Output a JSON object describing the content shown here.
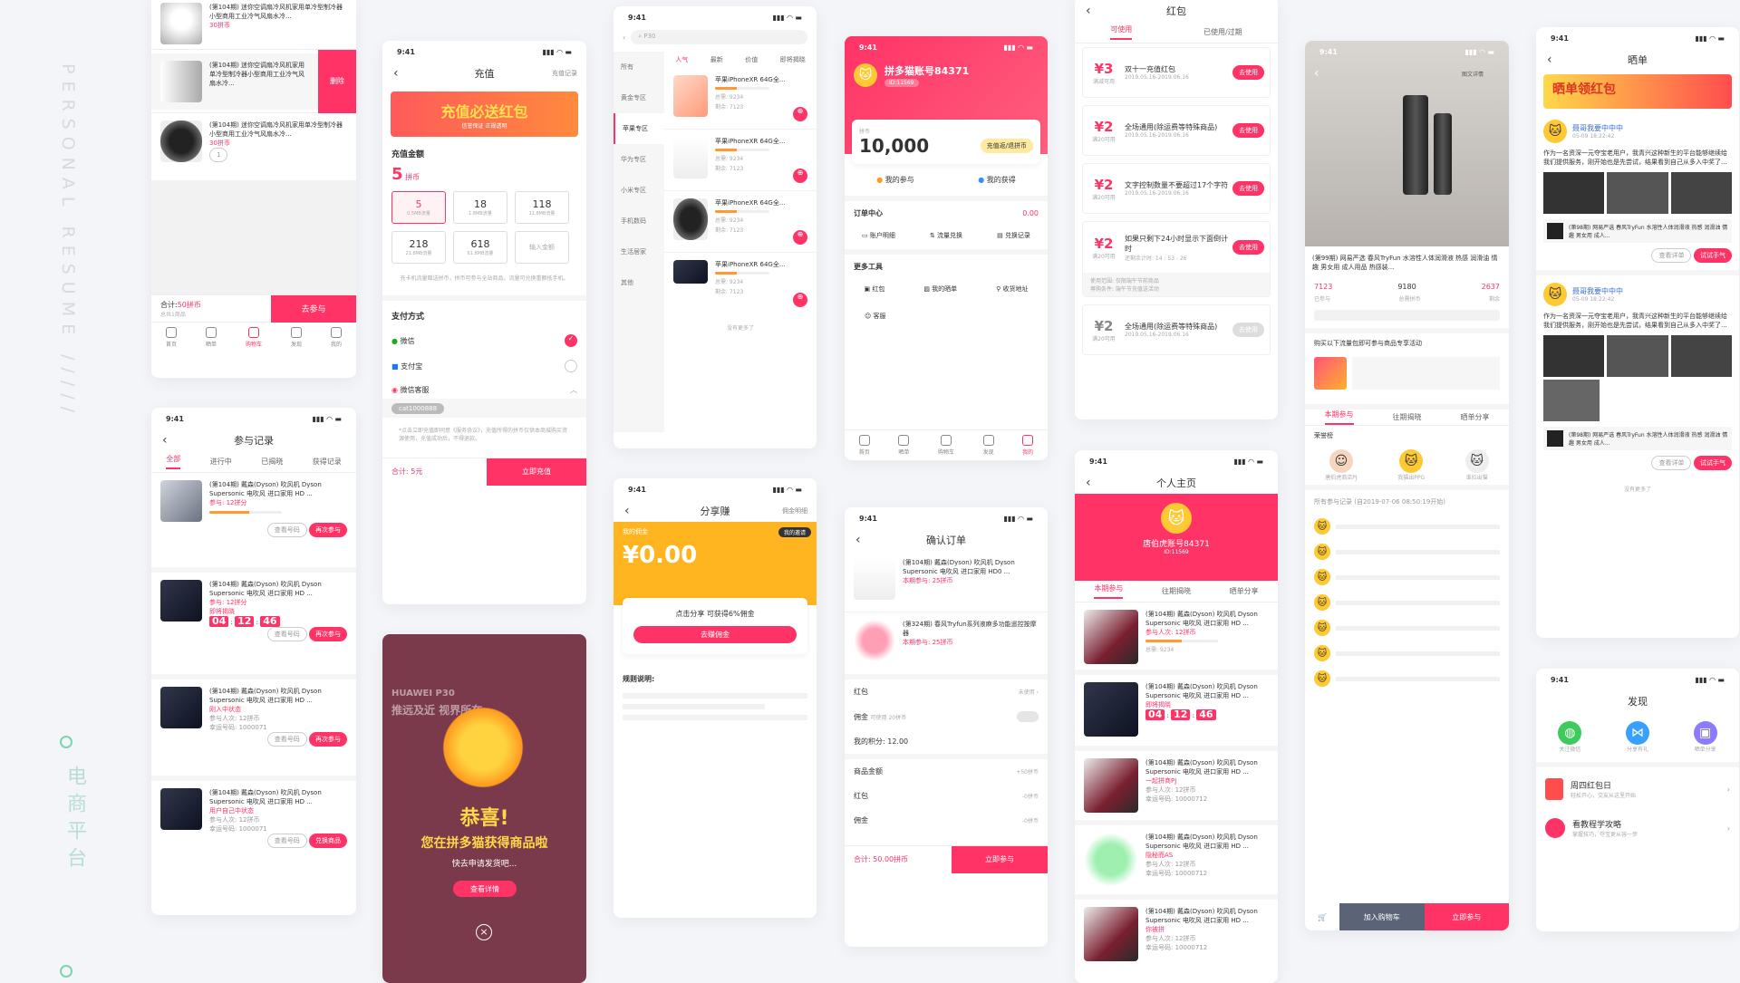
{
  "side": {
    "title": "PERSONAL RESUME /////",
    "cn": "电商平台"
  },
  "common": {
    "time": "9:41",
    "signal": "▮▮▮ ◠ ▬"
  },
  "cart": {
    "name": "(第104期) 迷你空调扇冷风机家用单冷型制冷器小型商用工业冷气风扇水冷...",
    "sum_label": "合计:",
    "sum": "50拼币",
    "count": "总共1商品",
    "go": "去参与",
    "del": "删除",
    "price": "30拼币",
    "qty": "1",
    "tabs": [
      "首页",
      "晒单",
      "购物车",
      "发现",
      "我的"
    ]
  },
  "records": {
    "title": "参与记录",
    "tabs": [
      "全部",
      "进行中",
      "已揭晓",
      "获得记录"
    ],
    "item": "(第104期) 戴森(Dyson) 吹风机 Dyson Supersonic 电吹风 进口家用 HD ...",
    "join": "参与: 12拼分",
    "joined": "参与人次: 12拼币",
    "num": "幸运号码: 1000071",
    "t1": "04",
    "t2": "12",
    "t3": "46",
    "status1": "即将揭晓",
    "status2": "刚入中状态",
    "status3": "用户自己中状态",
    "look": "查看号码",
    "again": "再次参与",
    "get": "兑换商品",
    "bars": "8234",
    "bars2": "7123"
  },
  "recharge": {
    "title": "充值",
    "right": "充值记录",
    "banner": "充值必送红包",
    "banner_sub": "信誉保证 正规透明",
    "amount_label": "充值金额",
    "amount": "5",
    "unit": "拼币",
    "tiles": [
      {
        "v": "5",
        "s": "0.5MB流量"
      },
      {
        "v": "18",
        "s": "1.8MB流量"
      },
      {
        "v": "118",
        "s": "11.8MB流量"
      },
      {
        "v": "218",
        "s": "21.8MB流量"
      },
      {
        "v": "618",
        "s": "61.8MB流量"
      },
      {
        "v": "输入金额",
        "s": ""
      }
    ],
    "note": "充卡机流量赠送拼币，拼币可参与全站商品。流量可兑换重额抵手机。",
    "pay": "支付方式",
    "m1": "微信",
    "m2": "支付宝",
    "m3": "微信客服",
    "sub": "充值",
    "code": "cat1000888",
    "sum": "合计: 5元",
    "btn": "立即充值",
    "tip": "*点击立即充值即同意《服务协议》，充值所得的拼币仅供本商城购买资源使用，充值成功后，不得退款。"
  },
  "prize": {
    "title": "恭喜!",
    "sub": "您在拼多猫获得商品啦",
    "desc": "快去申请发货吧...",
    "btn": "查看详情",
    "huawei": "HUAWEI P30",
    "slogan": "推远及近 视界所在"
  },
  "shop": {
    "search": "P30",
    "cats": [
      "所有",
      "黄金专区",
      "苹果专区",
      "华为专区",
      "小米专区",
      "手机数码",
      "生活居家",
      "其他"
    ],
    "sorts": [
      "人气",
      "最新",
      "价值",
      "即将揭晓"
    ],
    "item": "苹果iPhoneXR 64G全...",
    "total": "总需: 9234",
    "left": "剩余: 7123",
    "more": "没有更多了"
  },
  "share": {
    "title": "分享赚",
    "right": "佣金明细",
    "label": "我的佣金",
    "amount": "¥0.00",
    "badge": "我的邀请",
    "hint": "点击分享 可获得6%佣金",
    "btn": "去赚佣金",
    "rule": "规则说明:"
  },
  "my": {
    "name": "拼多猫账号84371",
    "id": "ID:11569",
    "coin_label": "拼币",
    "coin": "10,000",
    "btn": "充值返/退拼币",
    "a": "我的参与",
    "b": "我的获得",
    "center": "订单中心",
    "money": "0.00",
    "m1": "账户明细",
    "m2": "流量兑换",
    "m3": "兑换记录",
    "tools": "更多工具",
    "t1": "红包",
    "t2": "我的晒单",
    "t3": "收货地址",
    "t4": "客服",
    "tabs": [
      "首页",
      "晒单",
      "购物车",
      "发现",
      "我的"
    ]
  },
  "order": {
    "title": "确认订单",
    "i1": "(第104期) 戴森(Dyson) 吹风机 Dyson Supersonic 电吹风 进口家用 HD0 ...",
    "i2": "(第324期) 春风Tryfun系列液麻多功能遥控按摩器",
    "p1": "本期参与: 25拼币",
    "p2": "本期参与: 25拼币",
    "r1": "红包",
    "r1v": "未使用 ›",
    "r2": "佣金",
    "r2v": "可使用 20拼币",
    "r3": "我的积分: 12.00",
    "r4": "商品金额",
    "r4v": "+50拼币",
    "r5": "红包",
    "r5v": "-0拼币",
    "r6": "佣金",
    "r6v": "-0拼币",
    "sum": "合计: 50.00拼币",
    "btn": "立即参与"
  },
  "hb": {
    "title": "红包",
    "t1": "可使用",
    "t2": "已使用/过期",
    "items": [
      {
        "v": "¥3",
        "c": "满减可用",
        "n": "双十一充值红包",
        "d": "2019.05.16-2019.06.16"
      },
      {
        "v": "¥2",
        "c": "满20可用",
        "n": "全场通用(除运费等特殊商品)",
        "d": "2019.05.16-2019.06.16"
      },
      {
        "v": "¥2",
        "c": "满20可用",
        "n": "文字控制数量不要超过17个字符",
        "d": "2019.05.16-2019.06.16"
      },
      {
        "v": "¥2",
        "c": "满20可用",
        "n": "如果只剩下24小时显示下面倒计时",
        "d": "还剩余计时: 14 : 53 : 26"
      },
      {
        "v": "¥2",
        "c": "满20可用",
        "n": "全场通用(除运费等特殊商品)",
        "d": "2019.05.16-2019.06.16"
      }
    ],
    "use": "去使用",
    "soon": "使用范围: 仅限端午节前商品",
    "soon2": "尊购条件: 端午节充值送活动"
  },
  "home": {
    "title": "个人主页",
    "name": "唐伯虎账号84371",
    "id": "ID:11569",
    "tabs": [
      "本期参与",
      "往期揭晓",
      "晒单分享"
    ],
    "item": "(第104期) 戴森(Dyson) 吹风机 Dyson Supersonic 电吹风 进口家用 HD ...",
    "t1": "04",
    "t2": "12",
    "t3": "46",
    "s1": "即将揭晓",
    "s2": "一起拼商PJ",
    "s3": "隐秘而AS",
    "s4": "你被拼",
    "joined": "参与人次: 12拼币",
    "num": "幸运号码: 10000712",
    "total": "总需: 9234",
    "left": "剩余: 7123"
  },
  "detail": {
    "tag": "图文详情",
    "name": "(第99期) 网易严选 春风TryFun 水溶性人体润滑液 热感 润滑油 情趣 男女用 成人用品 热感装...",
    "v1": "7123",
    "v2": "9180",
    "v3": "2637",
    "l1": "已参与",
    "l2": "总需拼币",
    "l3": "剩余",
    "hint": "购买以下流量包即可参与商品专享活动",
    "tabs": [
      "本期参与",
      "往期揭晓",
      "晒单分享"
    ],
    "lucky": "荣誉榜",
    "u1": "唐伯虎商店PJ",
    "u2": "我猫出PPG",
    "u3": "谁拉出猫",
    "rec": "所有参与记录 (自2019-07-06 08:50:19开始)",
    "cart": "加入购物车",
    "buy": "立即参与"
  },
  "show": {
    "title": "晒单",
    "banner": "晒单领红包",
    "user": "聂哥我要中中中",
    "date": "05-09 18:22:42",
    "text": "作为一名资深一元夺宝老用户，我青兴这种新生的平台能够继续给我们提供服务，刚开始也是先尝试，结果看到自己从多入中奖了...",
    "prod": "(第98期) 网易严选 春风TryFun 水溶性人体润滑液 热感 润滑油 情趣 男女用 成人...",
    "btn1": "查看详单",
    "btn2": "试试手气",
    "more": "没有更多了"
  },
  "discover": {
    "title": "发现",
    "a": "关注微信",
    "b": "分享有礼",
    "c": "晒单分享",
    "d": "周四红包日",
    "d2": "轻松开心，交友从这里开始",
    "e": "看教程学攻略",
    "e2": "掌握技巧，夺宝更从容一步"
  }
}
